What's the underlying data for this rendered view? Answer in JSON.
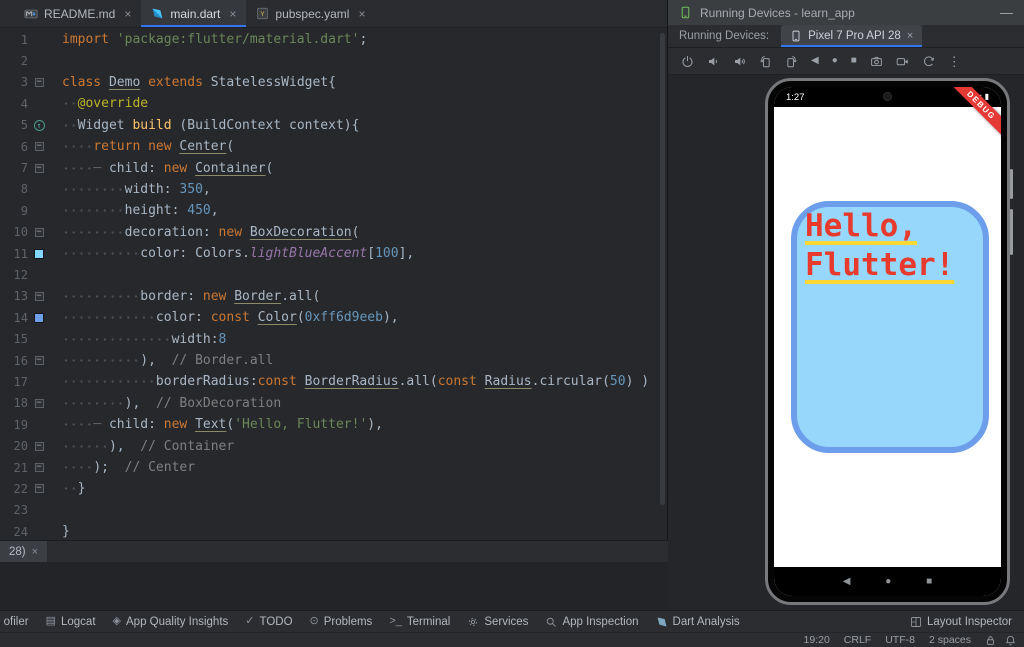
{
  "editor": {
    "tabs": [
      {
        "label": "README.md",
        "icon": "markdown-icon",
        "close_icon": "close-icon",
        "active": false
      },
      {
        "label": "main.dart",
        "icon": "dart-icon",
        "close_icon": "close-icon",
        "active": true
      },
      {
        "label": "pubspec.yaml",
        "icon": "yaml-icon",
        "close_icon": "close-icon",
        "active": false
      }
    ],
    "lines": [
      {
        "n": 1,
        "t": [
          [
            "kw",
            "import "
          ],
          [
            "str",
            "'package:flutter/material.dart'"
          ],
          [
            "pln",
            ";"
          ]
        ]
      },
      {
        "n": 2,
        "t": []
      },
      {
        "n": 3,
        "fold": "start",
        "t": [
          [
            "kw",
            "class "
          ],
          [
            "clsu",
            "Demo"
          ],
          [
            "kw",
            " extends"
          ],
          [
            "pln",
            " StatelessWidget{"
          ]
        ]
      },
      {
        "n": 4,
        "t": [
          [
            "ws",
            "  "
          ],
          [
            "ann",
            "@override"
          ]
        ]
      },
      {
        "n": 5,
        "marker": "override",
        "t": [
          [
            "ws",
            "  "
          ],
          [
            "pln",
            "Widget "
          ],
          [
            "fn",
            "build"
          ],
          [
            "pln",
            " (BuildContext context){"
          ]
        ]
      },
      {
        "n": 6,
        "fold": "start",
        "t": [
          [
            "ws",
            "    "
          ],
          [
            "kw",
            "return new "
          ],
          [
            "clsu",
            "Center"
          ],
          [
            "pln",
            "("
          ]
        ]
      },
      {
        "n": 7,
        "fold": "start",
        "t": [
          [
            "ws",
            "    "
          ],
          [
            "dash",
            "─ "
          ],
          [
            "pln",
            "child: "
          ],
          [
            "kw",
            "new "
          ],
          [
            "clsu",
            "Container"
          ],
          [
            "pln",
            "("
          ]
        ]
      },
      {
        "n": 8,
        "t": [
          [
            "ws",
            "        "
          ],
          [
            "pln",
            "width: "
          ],
          [
            "num",
            "350"
          ],
          [
            "pln",
            ","
          ]
        ]
      },
      {
        "n": 9,
        "t": [
          [
            "ws",
            "        "
          ],
          [
            "pln",
            "height: "
          ],
          [
            "num",
            "450"
          ],
          [
            "pln",
            ","
          ]
        ]
      },
      {
        "n": 10,
        "fold": "start",
        "t": [
          [
            "ws",
            "        "
          ],
          [
            "pln",
            "decoration: "
          ],
          [
            "kw",
            "new "
          ],
          [
            "clsu",
            "BoxDecoration"
          ],
          [
            "pln",
            "("
          ]
        ]
      },
      {
        "n": 11,
        "swatch": "#80d8ff",
        "t": [
          [
            "ws",
            "          "
          ],
          [
            "pln",
            "color: Colors."
          ],
          [
            "prop",
            "lightBlueAccent"
          ],
          [
            "pln",
            "["
          ],
          [
            "num",
            "100"
          ],
          [
            "pln",
            "],"
          ]
        ]
      },
      {
        "n": 12,
        "t": []
      },
      {
        "n": 13,
        "fold": "start",
        "t": [
          [
            "ws",
            "          "
          ],
          [
            "pln",
            "border: "
          ],
          [
            "kw",
            "new "
          ],
          [
            "clsu",
            "Border"
          ],
          [
            "pln",
            ".all("
          ]
        ]
      },
      {
        "n": 14,
        "swatch": "#6d9eeb",
        "t": [
          [
            "ws",
            "            "
          ],
          [
            "pln",
            "color: "
          ],
          [
            "kw",
            "const "
          ],
          [
            "clsu",
            "Color"
          ],
          [
            "pln",
            "("
          ],
          [
            "num",
            "0xff6d9eeb"
          ],
          [
            "pln",
            "),"
          ]
        ]
      },
      {
        "n": 15,
        "t": [
          [
            "ws",
            "              "
          ],
          [
            "pln",
            "width:"
          ],
          [
            "num",
            "8"
          ]
        ]
      },
      {
        "n": 16,
        "fold": "end",
        "t": [
          [
            "ws",
            "          "
          ],
          [
            "pln",
            "),  "
          ],
          [
            "cmt",
            "// Border.all"
          ]
        ]
      },
      {
        "n": 17,
        "t": [
          [
            "ws",
            "            "
          ],
          [
            "pln",
            "borderRadius:"
          ],
          [
            "kw",
            "const "
          ],
          [
            "clsu",
            "BorderRadius"
          ],
          [
            "pln",
            ".all("
          ],
          [
            "kw",
            "const "
          ],
          [
            "clsu",
            "Radius"
          ],
          [
            "pln",
            ".circular("
          ],
          [
            "num",
            "50"
          ],
          [
            "pln",
            ") )"
          ]
        ]
      },
      {
        "n": 18,
        "fold": "end",
        "t": [
          [
            "ws",
            "        "
          ],
          [
            "pln",
            "),  "
          ],
          [
            "cmt",
            "// BoxDecoration"
          ]
        ]
      },
      {
        "n": 19,
        "t": [
          [
            "ws",
            "    "
          ],
          [
            "dash",
            "─ "
          ],
          [
            "pln",
            "child: "
          ],
          [
            "kw",
            "new "
          ],
          [
            "clsu",
            "Text"
          ],
          [
            "pln",
            "("
          ],
          [
            "str",
            "'Hello, Flutter!'"
          ],
          [
            "pln",
            "),"
          ]
        ]
      },
      {
        "n": 20,
        "fold": "end",
        "t": [
          [
            "ws",
            "      "
          ],
          [
            "pln",
            "),  "
          ],
          [
            "cmt",
            "// Container"
          ]
        ]
      },
      {
        "n": 21,
        "fold": "end",
        "t": [
          [
            "ws",
            "    "
          ],
          [
            "pln",
            ");  "
          ],
          [
            "cmt",
            "// Center"
          ]
        ]
      },
      {
        "n": 22,
        "fold": "end",
        "t": [
          [
            "ws",
            "  "
          ],
          [
            "pln",
            "}"
          ]
        ]
      },
      {
        "n": 23,
        "t": []
      },
      {
        "n": 24,
        "t": [
          [
            "pln",
            "}"
          ]
        ]
      }
    ]
  },
  "partial_tab": {
    "label": "28)",
    "close_icon": "close-icon"
  },
  "devices_panel": {
    "title": "Running Devices - learn_app",
    "window_icon": "device-icon",
    "minimize_icon": "minimize-icon",
    "tabs_label": "Running Devices:",
    "device_tab": {
      "label": "Pixel 7 Pro API 28",
      "icon": "phone-icon",
      "close_icon": "close-icon"
    },
    "toolbar_icons": [
      "power-icon",
      "volume-down-icon",
      "volume-up-icon",
      "rotate-left-icon",
      "rotate-right-icon",
      "back-icon",
      "home-icon",
      "overview-icon",
      "screenshot-icon",
      "record-icon",
      "snapshots-icon",
      "more-icon"
    ],
    "phone": {
      "status_time": "1:27",
      "status_icons": [
        "wifi-icon",
        "battery-icon"
      ],
      "debug_banner": "DEBUG",
      "app_text_line1": "Hello,",
      "app_text_line2": "Flutter!",
      "container_fill": "#97d7fb",
      "container_border": "#6d9eeb",
      "text_color": "#e8392d",
      "underline_color": "#fdd835",
      "nav_icons": [
        "nav-back-icon",
        "nav-home-icon",
        "nav-overview-icon"
      ]
    }
  },
  "bottom_bar": {
    "left_items": [
      {
        "label": "ofiler",
        "icon": "profiler-icon"
      },
      {
        "label": "Logcat",
        "icon": "logcat-icon"
      },
      {
        "label": "App Quality Insights",
        "icon": "aqi-icon"
      },
      {
        "label": "TODO",
        "icon": "todo-icon"
      },
      {
        "label": "Problems",
        "icon": "problems-icon"
      },
      {
        "label": "Terminal",
        "icon": "terminal-icon"
      },
      {
        "label": "Services",
        "icon": "services-icon"
      },
      {
        "label": "App Inspection",
        "icon": "inspection-icon"
      },
      {
        "label": "Dart Analysis",
        "icon": "dart-analysis-icon"
      }
    ],
    "right_items": [
      {
        "label": "Layout Inspector",
        "icon": "layout-inspector-icon"
      }
    ]
  },
  "status_bar": {
    "caret": "19:20",
    "line_ending": "CRLF",
    "encoding": "UTF-8",
    "indent": "2 spaces",
    "icons": [
      "lock-icon",
      "notifications-icon"
    ]
  }
}
